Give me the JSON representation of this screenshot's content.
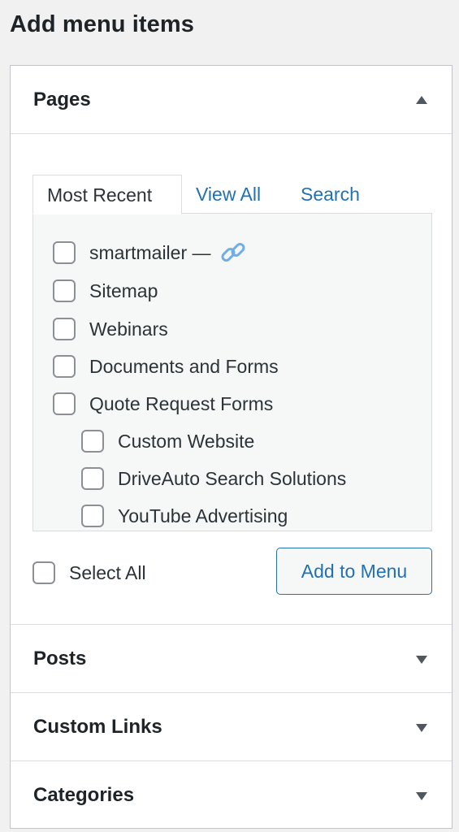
{
  "page": {
    "title": "Add menu items"
  },
  "pages_section": {
    "title": "Pages",
    "tabs": [
      {
        "label": "Most Recent",
        "active": true
      },
      {
        "label": "View All",
        "active": false
      },
      {
        "label": "Search",
        "active": false
      }
    ],
    "items": [
      {
        "label": "smartmailer —",
        "has_link_icon": true,
        "level": 0,
        "checked": false
      },
      {
        "label": "Sitemap",
        "level": 0,
        "checked": false
      },
      {
        "label": "Webinars",
        "level": 0,
        "checked": false
      },
      {
        "label": "Documents and Forms",
        "level": 0,
        "checked": false
      },
      {
        "label": "Quote Request Forms",
        "level": 0,
        "checked": false
      },
      {
        "label": "Custom Website",
        "level": 1,
        "checked": false
      },
      {
        "label": "DriveAuto Search Solutions",
        "level": 1,
        "checked": false
      },
      {
        "label": "YouTube Advertising",
        "level": 1,
        "checked": false
      }
    ],
    "select_all_label": "Select All",
    "add_button_label": "Add to Menu"
  },
  "collapsed_sections": [
    {
      "title": "Posts"
    },
    {
      "title": "Custom Links"
    },
    {
      "title": "Categories"
    }
  ],
  "colors": {
    "link": "#2271b1",
    "text": "#1d2327",
    "border": "#c3c4c7",
    "list_background": "#f6f7f7",
    "link_icon": "#72aee6"
  },
  "icons": {
    "pages_toggle": "triangle-up-icon",
    "collapsed_toggle": "triangle-down-icon",
    "link": "chain-link-icon"
  }
}
